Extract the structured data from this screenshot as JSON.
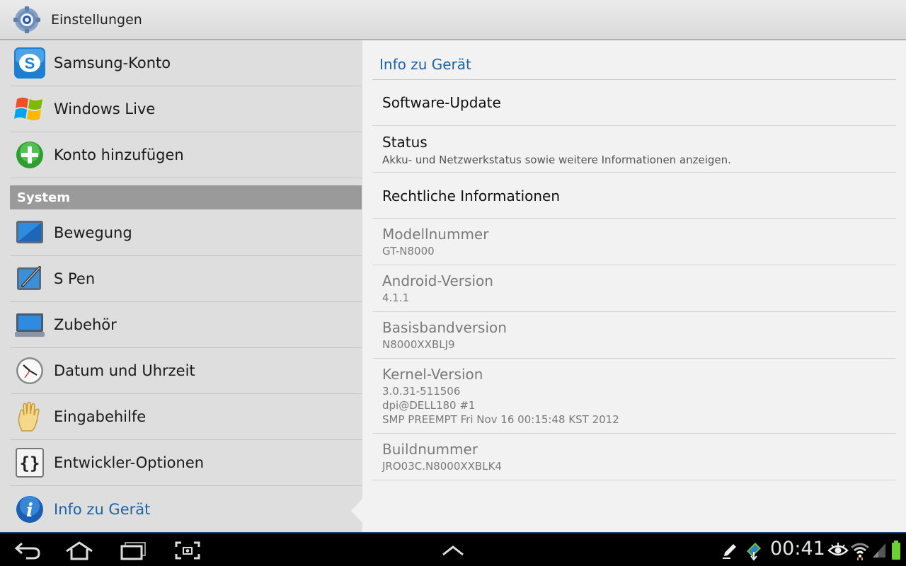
{
  "app": {
    "title": "Einstellungen",
    "icon": "settings-gear-icon"
  },
  "left_items_top": [
    {
      "name": "samsung-konto",
      "label": "Samsung-Konto",
      "icon": "samsung-account-icon"
    },
    {
      "name": "windows-live",
      "label": "Windows Live",
      "icon": "windows-live-icon"
    },
    {
      "name": "konto-hinzufuegen",
      "label": "Konto hinzufügen",
      "icon": "add-account-icon"
    }
  ],
  "system_header": "System",
  "left_items_system": [
    {
      "name": "bewegung",
      "label": "Bewegung",
      "icon": "motion-icon"
    },
    {
      "name": "s-pen",
      "label": "S Pen",
      "icon": "s-pen-icon"
    },
    {
      "name": "zubehoer",
      "label": "Zubehör",
      "icon": "accessory-icon"
    },
    {
      "name": "datum-uhrzeit",
      "label": "Datum und Uhrzeit",
      "icon": "clock-icon"
    },
    {
      "name": "eingabehilfe",
      "label": "Eingabehilfe",
      "icon": "accessibility-hand-icon"
    },
    {
      "name": "entwickler-optionen",
      "label": "Entwickler-Optionen",
      "icon": "developer-braces-icon"
    },
    {
      "name": "info-zu-geraet",
      "label": "Info zu Gerät",
      "icon": "info-icon",
      "active": true
    }
  ],
  "detail": {
    "header": "Info zu Gerät",
    "items": [
      {
        "title": "Software-Update"
      },
      {
        "title": "Status",
        "summary": "Akku- und Netzwerkstatus sowie weitere Informationen anzeigen."
      },
      {
        "title": "Rechtliche Informationen"
      },
      {
        "title": "Modellnummer",
        "summary": "GT-N8000",
        "disabled": true
      },
      {
        "title": "Android-Version",
        "summary": "4.1.1",
        "disabled": true
      },
      {
        "title": "Basisbandversion",
        "summary": "N8000XXBLJ9",
        "disabled": true
      },
      {
        "title": "Kernel-Version",
        "summary_lines": [
          "3.0.31-511506",
          "dpi@DELL180 #1",
          "SMP PREEMPT Fri Nov 16 00:15:48 KST 2012"
        ],
        "disabled": true
      },
      {
        "title": "Buildnummer",
        "summary": "JRO03C.N8000XXBLK4",
        "disabled": true
      }
    ]
  },
  "system_bar": {
    "clock": "00:41",
    "nav": [
      "back-icon",
      "home-icon",
      "recent-apps-icon",
      "screenshot-icon"
    ],
    "center": "chevron-up-icon",
    "status_icons": [
      "pen-icon",
      "download-icon",
      "smart-stay-eye-icon",
      "wifi-icon",
      "signal-icon",
      "battery-icon"
    ]
  }
}
